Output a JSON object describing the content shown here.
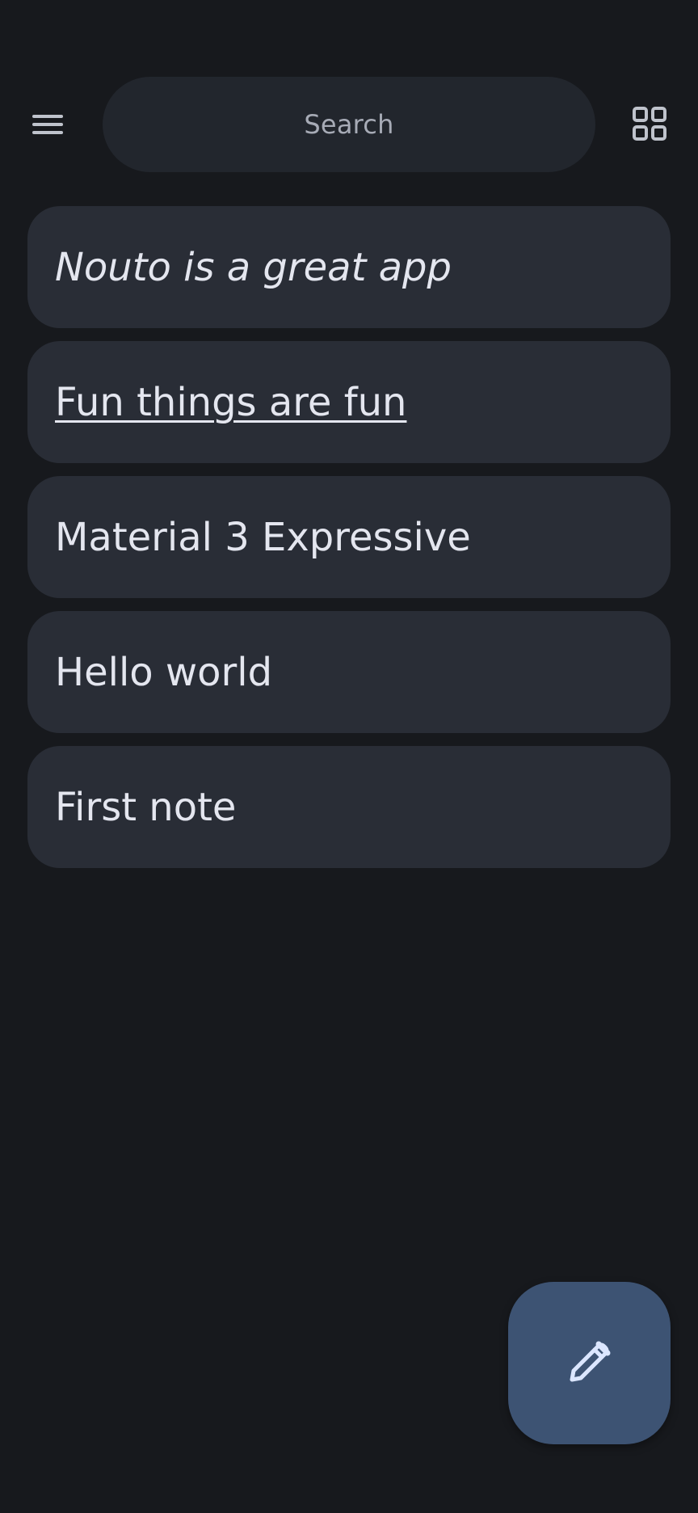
{
  "header": {
    "search_placeholder": "Search",
    "menu_icon": "menu-icon",
    "view_toggle_icon": "grid-view-icon"
  },
  "notes": [
    {
      "title": "Nouto is a great app",
      "style": "italic"
    },
    {
      "title": "Fun things are fun",
      "style": "underline"
    },
    {
      "title": "Material 3 Expressive",
      "style": "normal"
    },
    {
      "title": "Hello world",
      "style": "normal"
    },
    {
      "title": "First note",
      "style": "normal"
    }
  ],
  "fab": {
    "icon": "edit-icon"
  },
  "colors": {
    "background": "#17191d",
    "search_bar": "#22262d",
    "note_card": "#292d36",
    "text": "#e4e6ef",
    "muted_text": "#a7abb6",
    "fab": "#3d5373",
    "fab_icon": "#dbe6ff"
  }
}
